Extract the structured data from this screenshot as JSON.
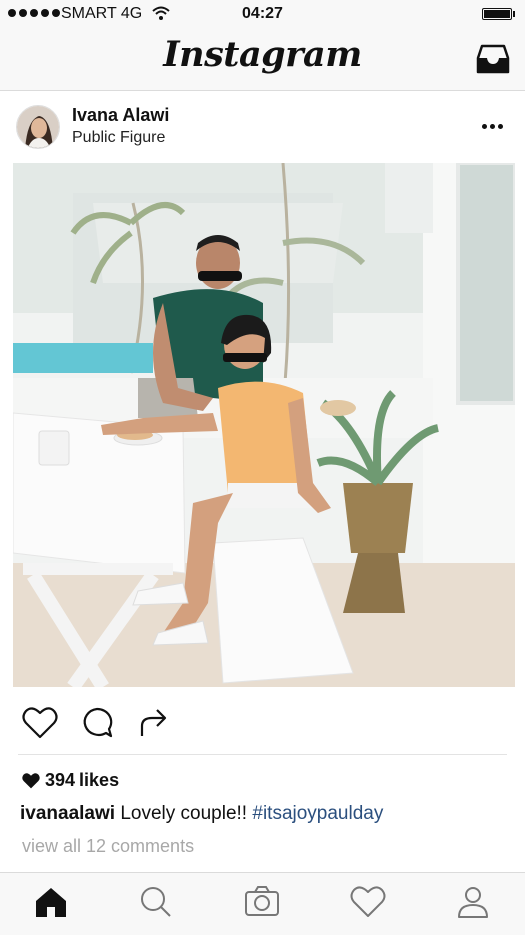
{
  "status_bar": {
    "carrier": "SMART 4G",
    "time": "04:27",
    "battery_level_percent": 100
  },
  "header": {
    "logo": "Instagram",
    "inbox_icon": "inbox-tray-icon"
  },
  "post": {
    "username": "Ivana Alawi",
    "subtitle": "Public Figure",
    "more_icon": "more-horizontal-icon",
    "likes_count": "394",
    "likes_label": "likes",
    "caption_user": "ivanaalawi",
    "caption_text": "Lovely couple!!",
    "hashtag": "#itsajoypaulday",
    "view_comments": "view all 12 comments"
  },
  "actions": [
    "heart-outline-icon",
    "comment-bubble-icon",
    "share-arrow-icon"
  ],
  "tab_bar": [
    "home-icon",
    "search-icon",
    "camera-icon",
    "activity-heart-icon",
    "profile-icon"
  ],
  "colors": {
    "bar_bg": "#f8f8f8",
    "hashtag": "#2b4f7e",
    "muted_text": "#a8a8a8",
    "divider": "#dbdbdb"
  }
}
